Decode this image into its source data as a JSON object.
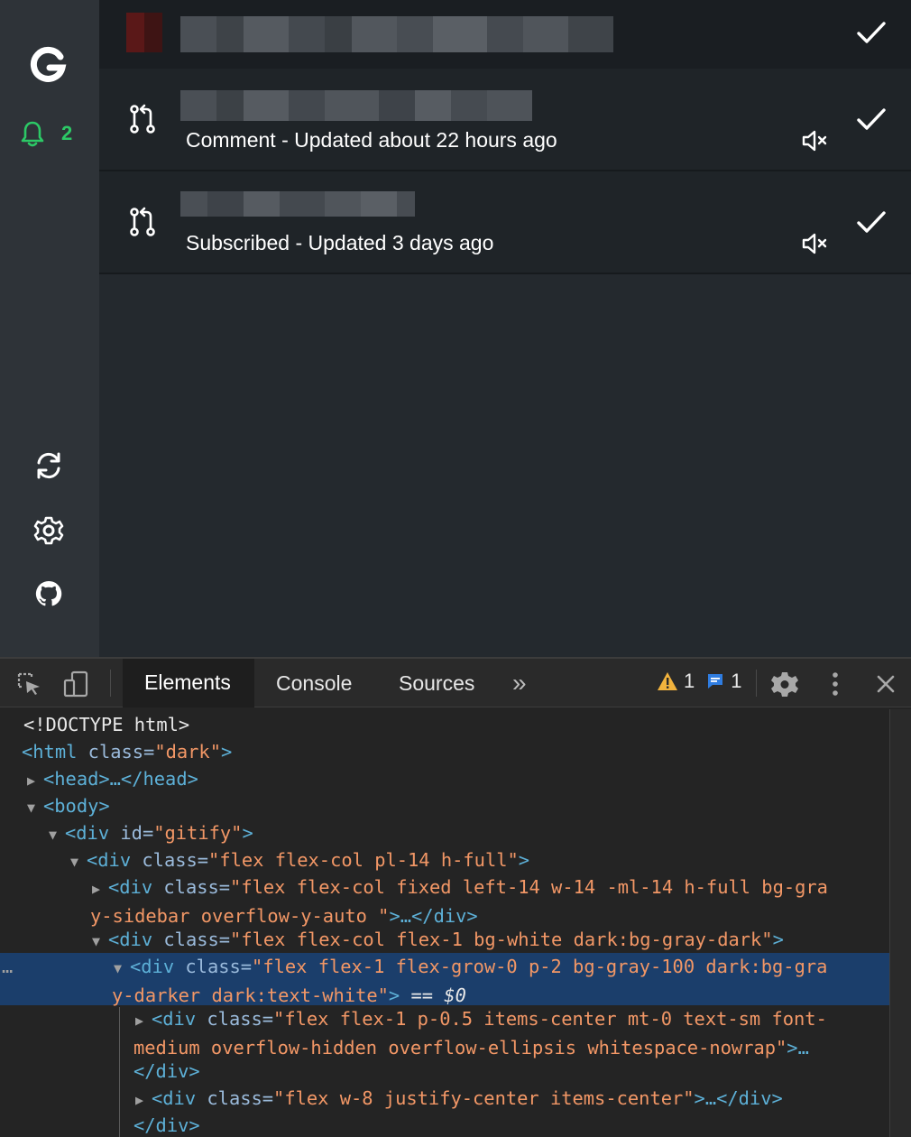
{
  "app": {
    "sidebar": {
      "unread_count": "2",
      "icons": [
        "gitify-logo-icon",
        "bell-icon",
        "sync-icon",
        "gear-icon",
        "github-icon"
      ]
    },
    "notifications": [
      {
        "meta": "Comment - Updated about 22 hours ago",
        "icon": "pull-request-icon"
      },
      {
        "meta": "Subscribed - Updated 3 days ago",
        "icon": "pull-request-icon"
      }
    ],
    "colors": {
      "accent_green": "#2cc966",
      "sidebar_bg": "#2e3338",
      "main_bg": "#24292e"
    }
  },
  "devtools": {
    "tabs": [
      "Elements",
      "Console",
      "Sources"
    ],
    "more_tabs": "»",
    "warnings": "1",
    "messages": "1",
    "dom": {
      "l1": "<!DOCTYPE html>",
      "l2_tag": "<html",
      "l2_attr": " class=",
      "l2_val": "\"dark\"",
      "l2_end": ">",
      "l3": "<head>…</head>",
      "l4": "<body>",
      "l5_tag": "<div",
      "l5_attr": " id=",
      "l5_val": "\"gitify\"",
      "l5_end": ">",
      "l6_tag": "<div",
      "l6_attr": " class=",
      "l6_val": "\"flex flex-col pl-14 h-full\"",
      "l6_end": ">",
      "l7_tag": "<div",
      "l7_attr": " class=",
      "l7_val_a": "\"flex flex-col fixed left-14 w-14 -ml-14 h-full bg-gra",
      "l7_val_b": "y-sidebar overflow-y-auto   \"",
      "l7_end": ">…</div>",
      "l8_tag": "<div",
      "l8_attr": " class=",
      "l8_val": "\"flex flex-col flex-1 bg-white dark:bg-gray-dark\"",
      "l8_end": ">",
      "l9_dots": "…",
      "l9_tag": "<div",
      "l9_attr": " class=",
      "l9_val_a": "\"flex flex-1 flex-grow-0 p-2 bg-gray-100 dark:bg-gra",
      "l9_val_b": "y-darker dark:text-white\"",
      "l9_end": ">",
      "l9_eq": " == ",
      "l9_dollar": "$0",
      "l10_tag": "<div",
      "l10_attr": " class=",
      "l10_val_a": "\"flex flex-1 p-0.5 items-center mt-0 text-sm font-",
      "l10_val_b": "medium overflow-hidden overflow-ellipsis whitespace-nowrap\"",
      "l10_end": ">…",
      "l11": "</div>",
      "l12_tag": "<div",
      "l12_attr": " class=",
      "l12_val": "\"flex w-8 justify-center items-center\"",
      "l12_end": ">…</div>",
      "l13": "</div>"
    }
  }
}
